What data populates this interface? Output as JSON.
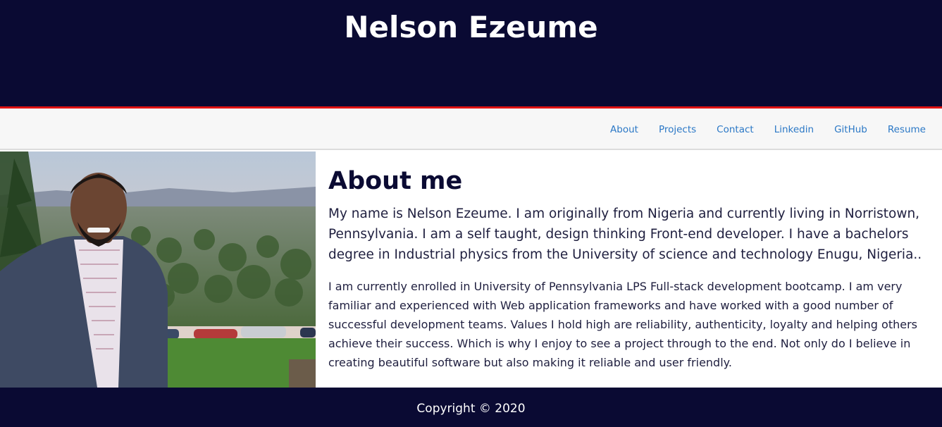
{
  "header": {
    "title": "Nelson Ezeume"
  },
  "nav": {
    "items": [
      {
        "label": "About"
      },
      {
        "label": "Projects"
      },
      {
        "label": "Contact"
      },
      {
        "label": "Linkedin"
      },
      {
        "label": "GitHub"
      },
      {
        "label": "Resume"
      }
    ]
  },
  "about": {
    "heading": "About me",
    "intro": "My name is Nelson Ezeume. I am originally from Nigeria and currently living in Norristown, Pennsylvania. I am a self taught, design thinking Front-end developer. I have a bachelors degree in Industrial physics from the University of science and technology Enugu, Nigeria..",
    "details": "I am currently enrolled in University of Pennsylvania LPS Full-stack development bootcamp. I am very familiar and experienced with Web application frameworks and have worked with a good number of successful development teams. Values I hold high are reliability, authenticity, loyalty and helping others achieve their success. Which is why I enjoy to see a project through to the end. Not only do I believe in creating beautiful software but also making it reliable and user friendly."
  },
  "footer": {
    "copyright": "Copyright © 2020"
  },
  "colors": {
    "header_bg": "#0a0a33",
    "accent_rule": "#e01313",
    "nav_link": "#2b78c6",
    "nav_bg": "#f7f7f7"
  }
}
